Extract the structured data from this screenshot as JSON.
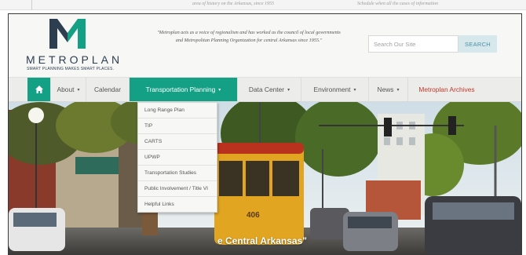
{
  "top_strip": {
    "text_left": "area of history on the Arkansas, since 1955",
    "text_right": "Schedule when all the cases of information"
  },
  "brand": {
    "name": "METROPLAN",
    "tagline": "SMART PLANNING MAKES SMART PLACES.",
    "colors": {
      "teal": "#14a084",
      "navy": "#2c3e50"
    }
  },
  "header": {
    "quote": "\"Metroplan acts as a voice of regionalism and has worked as the council of local governments and Metropolitan Planning Organization for central Arkansas since 1955.\""
  },
  "search": {
    "placeholder": "Search Our Site",
    "button": "SEARCH"
  },
  "nav": {
    "home_icon": "home-icon",
    "items": [
      {
        "label": "About",
        "dropdown": true
      },
      {
        "label": "Calendar",
        "dropdown": false
      },
      {
        "label": "Transportation Planning",
        "dropdown": true,
        "active": true
      },
      {
        "label": "Data Center",
        "dropdown": true
      },
      {
        "label": "Environment",
        "dropdown": true
      },
      {
        "label": "News",
        "dropdown": true
      },
      {
        "label": "Metroplan Archives",
        "dropdown": false
      }
    ]
  },
  "dropdown": {
    "items": [
      "Long Range Plan",
      "TIP",
      "CARTS",
      "UPWP",
      "Transportation Studies",
      "Public Involvement / Title VI",
      "Helpful Links"
    ]
  },
  "hero": {
    "caption": "e Central Arkansas\"",
    "streetcar_number": "406"
  }
}
